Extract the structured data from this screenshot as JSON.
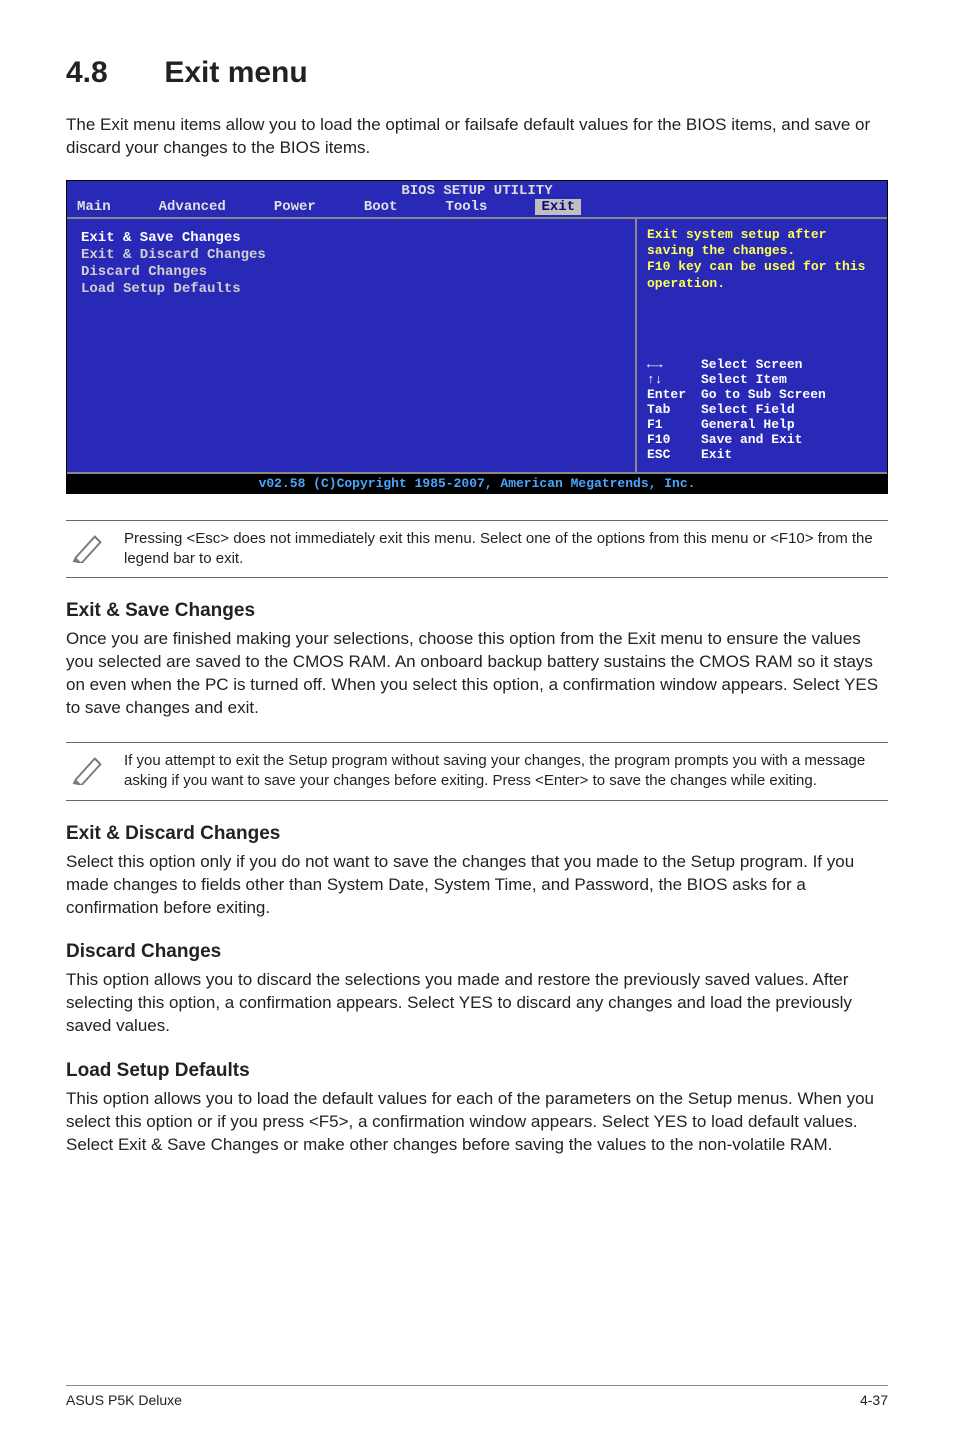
{
  "section": {
    "number": "4.8",
    "title": "Exit menu"
  },
  "intro": "The Exit menu items allow you to load the optimal or failsafe default values for the BIOS items, and save or discard your changes to the BIOS items.",
  "bios": {
    "title": "BIOS SETUP UTILITY",
    "tabs": [
      "Main",
      "Advanced",
      "Power",
      "Boot",
      "Tools",
      "Exit"
    ],
    "selected_tab": "Exit",
    "menu_items": [
      "Exit & Save Changes",
      "Exit & Discard Changes",
      "Discard Changes",
      "",
      "Load Setup Defaults"
    ],
    "help_lines": [
      "Exit system setup after saving the changes.",
      "",
      "F10 key can be used for this operation."
    ],
    "key_legend": [
      {
        "k": "←→",
        "v": "Select Screen"
      },
      {
        "k": "↑↓",
        "v": "Select Item"
      },
      {
        "k": "Enter",
        "v": "Go to Sub Screen"
      },
      {
        "k": "Tab",
        "v": "Select Field"
      },
      {
        "k": "F1",
        "v": "General Help"
      },
      {
        "k": "F10",
        "v": "Save and Exit"
      },
      {
        "k": "ESC",
        "v": "Exit"
      }
    ],
    "footer": "v02.58 (C)Copyright 1985-2007, American Megatrends, Inc."
  },
  "note1": "Pressing <Esc> does not immediately exit this menu. Select one of the options from this menu or <F10> from the legend bar to exit.",
  "sections": {
    "save": {
      "h": "Exit & Save Changes",
      "p": "Once you are finished making your selections, choose this option from the Exit menu to ensure the values you selected are saved to the CMOS RAM. An onboard backup battery sustains the CMOS RAM so it stays on even when the PC is turned off. When you select this option, a confirmation window appears. Select YES to save changes and exit."
    },
    "note2": "If you attempt to exit the Setup program without saving your changes, the program prompts you with a message asking if you want to save your changes before exiting. Press <Enter> to save the changes while exiting.",
    "discard_exit": {
      "h": "Exit & Discard Changes",
      "p": "Select this option only if you do not want to save the changes that you  made to the Setup program. If you made changes to fields other than System Date, System Time, and Password, the BIOS asks for a confirmation before exiting."
    },
    "discard": {
      "h": "Discard Changes",
      "p": "This option allows you to discard the selections you made and restore the previously saved values. After selecting this option, a confirmation appears. Select YES to discard any changes and load the previously saved values."
    },
    "defaults": {
      "h": "Load Setup Defaults",
      "p": "This option allows you to load the default values for each of the parameters on the Setup menus. When you select this option or if you press <F5>, a confirmation window appears. Select YES to load default values. Select Exit & Save Changes or make other changes before saving the values to the non-volatile RAM."
    }
  },
  "footer": {
    "left": "ASUS P5K Deluxe",
    "right": "4-37"
  }
}
